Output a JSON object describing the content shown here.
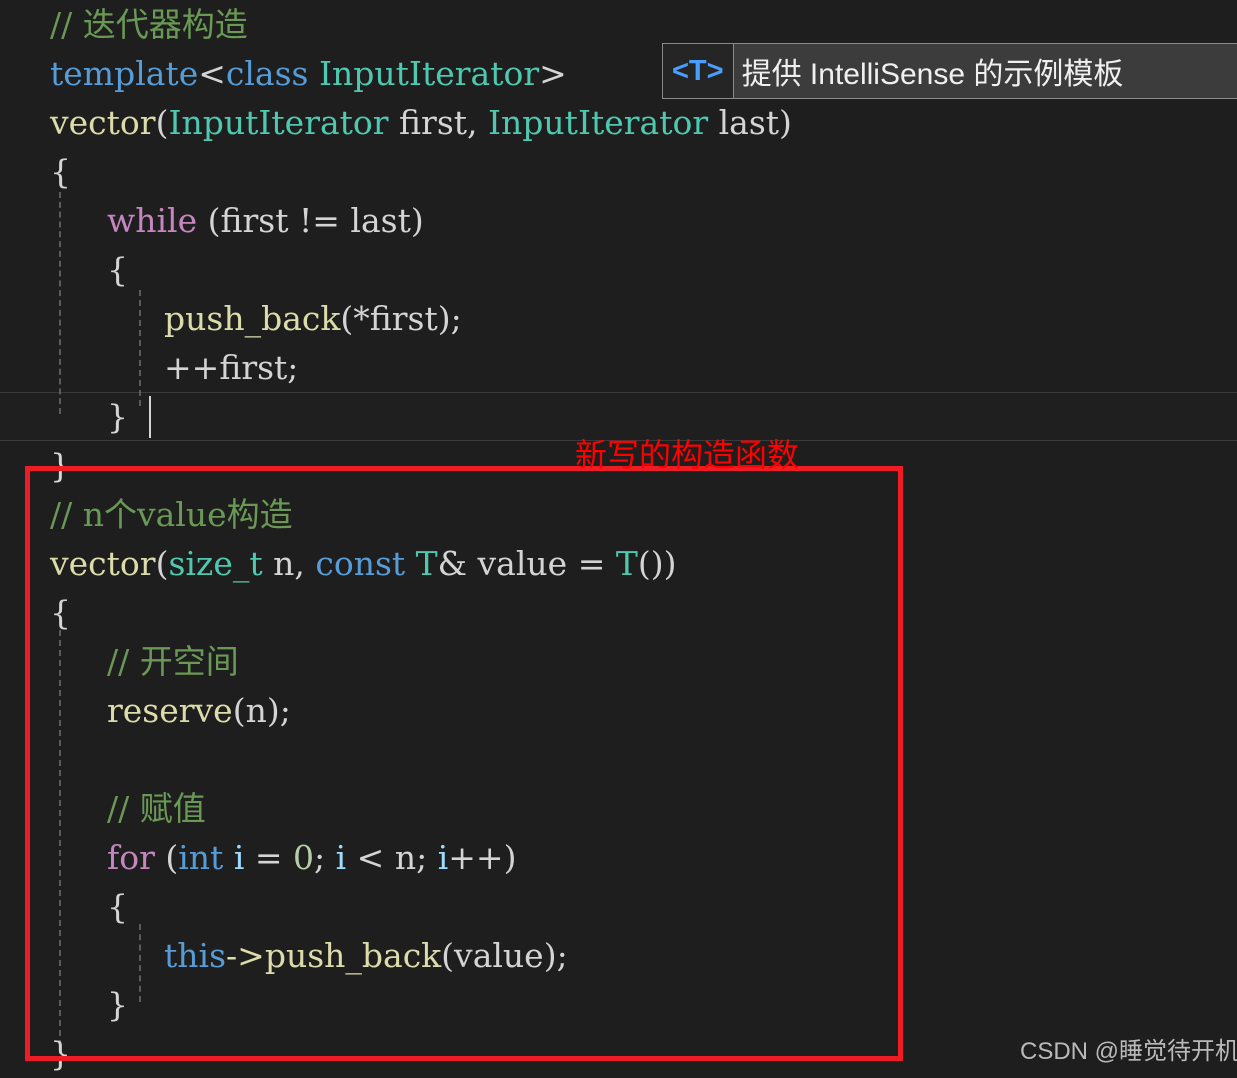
{
  "editor": {
    "background_color": "#1e1e1e",
    "font_size_px": 33,
    "line_height_px": 49,
    "current_line_index": 8,
    "lines": [
      {
        "indent": 0,
        "tokens": [
          {
            "text": "// 迭代器构造",
            "type": "comment"
          }
        ]
      },
      {
        "indent": 0,
        "tokens": [
          {
            "text": "template",
            "type": "keyword"
          },
          {
            "text": "<",
            "type": "punct"
          },
          {
            "text": "class",
            "type": "keyword"
          },
          {
            "text": " ",
            "type": "plain"
          },
          {
            "text": "InputIterator",
            "type": "type"
          },
          {
            "text": ">",
            "type": "punct"
          }
        ]
      },
      {
        "indent": 0,
        "tokens": [
          {
            "text": "vector",
            "type": "func"
          },
          {
            "text": "(",
            "type": "punct"
          },
          {
            "text": "InputIterator",
            "type": "type"
          },
          {
            "text": " first",
            "type": "plain"
          },
          {
            "text": ", ",
            "type": "punct"
          },
          {
            "text": "InputIterator",
            "type": "type"
          },
          {
            "text": " last",
            "type": "plain"
          },
          {
            "text": ")",
            "type": "punct"
          }
        ]
      },
      {
        "indent": 0,
        "tokens": [
          {
            "text": "{",
            "type": "punct"
          }
        ]
      },
      {
        "indent": 1,
        "tokens": [
          {
            "text": "while",
            "type": "ctrl"
          },
          {
            "text": " (",
            "type": "punct"
          },
          {
            "text": "first",
            "type": "plain"
          },
          {
            "text": " != ",
            "type": "punct"
          },
          {
            "text": "last",
            "type": "plain"
          },
          {
            "text": ")",
            "type": "punct"
          }
        ]
      },
      {
        "indent": 1,
        "tokens": [
          {
            "text": "{",
            "type": "punct"
          }
        ]
      },
      {
        "indent": 2,
        "tokens": [
          {
            "text": "push_back",
            "type": "func"
          },
          {
            "text": "(*",
            "type": "punct"
          },
          {
            "text": "first",
            "type": "plain"
          },
          {
            "text": ");",
            "type": "punct"
          }
        ]
      },
      {
        "indent": 2,
        "tokens": [
          {
            "text": "++",
            "type": "punct"
          },
          {
            "text": "first",
            "type": "plain"
          },
          {
            "text": ";",
            "type": "punct"
          }
        ]
      },
      {
        "indent": 1,
        "tokens": [
          {
            "text": "}",
            "type": "punct"
          }
        ]
      },
      {
        "indent": 0,
        "tokens": [
          {
            "text": "}",
            "type": "punct"
          }
        ]
      },
      {
        "indent": 0,
        "tokens": [
          {
            "text": "// n个value构造",
            "type": "comment"
          }
        ]
      },
      {
        "indent": 0,
        "tokens": [
          {
            "text": "vector",
            "type": "func"
          },
          {
            "text": "(",
            "type": "punct"
          },
          {
            "text": "size_t",
            "type": "type"
          },
          {
            "text": " n",
            "type": "plain"
          },
          {
            "text": ", ",
            "type": "punct"
          },
          {
            "text": "const",
            "type": "keyword"
          },
          {
            "text": " ",
            "type": "plain"
          },
          {
            "text": "T",
            "type": "type"
          },
          {
            "text": "&",
            "type": "punct"
          },
          {
            "text": " value",
            "type": "plain"
          },
          {
            "text": " = ",
            "type": "punct"
          },
          {
            "text": "T",
            "type": "type"
          },
          {
            "text": "())",
            "type": "punct"
          }
        ]
      },
      {
        "indent": 0,
        "tokens": [
          {
            "text": "{",
            "type": "punct"
          }
        ]
      },
      {
        "indent": 1,
        "tokens": [
          {
            "text": "// 开空间",
            "type": "comment"
          }
        ]
      },
      {
        "indent": 1,
        "tokens": [
          {
            "text": "reserve",
            "type": "func"
          },
          {
            "text": "(",
            "type": "punct"
          },
          {
            "text": "n",
            "type": "plain"
          },
          {
            "text": ");",
            "type": "punct"
          }
        ]
      },
      {
        "indent": 0,
        "tokens": []
      },
      {
        "indent": 1,
        "tokens": [
          {
            "text": "// 赋值",
            "type": "comment"
          }
        ]
      },
      {
        "indent": 1,
        "tokens": [
          {
            "text": "for",
            "type": "ctrl"
          },
          {
            "text": " (",
            "type": "punct"
          },
          {
            "text": "int",
            "type": "keyword"
          },
          {
            "text": " ",
            "type": "plain"
          },
          {
            "text": "i",
            "type": "var"
          },
          {
            "text": " = ",
            "type": "punct"
          },
          {
            "text": "0",
            "type": "num"
          },
          {
            "text": "; ",
            "type": "punct"
          },
          {
            "text": "i",
            "type": "var"
          },
          {
            "text": " < ",
            "type": "punct"
          },
          {
            "text": "n",
            "type": "plain"
          },
          {
            "text": "; ",
            "type": "punct"
          },
          {
            "text": "i",
            "type": "var"
          },
          {
            "text": "++)",
            "type": "punct"
          }
        ]
      },
      {
        "indent": 1,
        "tokens": [
          {
            "text": "{",
            "type": "punct"
          }
        ]
      },
      {
        "indent": 2,
        "tokens": [
          {
            "text": "this",
            "type": "keyword"
          },
          {
            "text": "->",
            "type": "func"
          },
          {
            "text": "push_back",
            "type": "func"
          },
          {
            "text": "(",
            "type": "punct"
          },
          {
            "text": "value",
            "type": "plain"
          },
          {
            "text": ");",
            "type": "punct"
          }
        ]
      },
      {
        "indent": 1,
        "tokens": [
          {
            "text": "}",
            "type": "punct"
          }
        ]
      },
      {
        "indent": 0,
        "tokens": [
          {
            "text": "}",
            "type": "punct"
          }
        ]
      }
    ]
  },
  "tooltip": {
    "tag": "<T>",
    "description": "提供 IntelliSense 的示例模板",
    "tag_color": "#4a9eff",
    "background_color": "#3c3c3c",
    "border_color": "#8a8a8a"
  },
  "annotation": {
    "label": "新写的构造函数",
    "color": "#ff0000",
    "box_border_color": "#ee1c25"
  },
  "watermark": {
    "text": "CSDN @睡觉待开机"
  }
}
